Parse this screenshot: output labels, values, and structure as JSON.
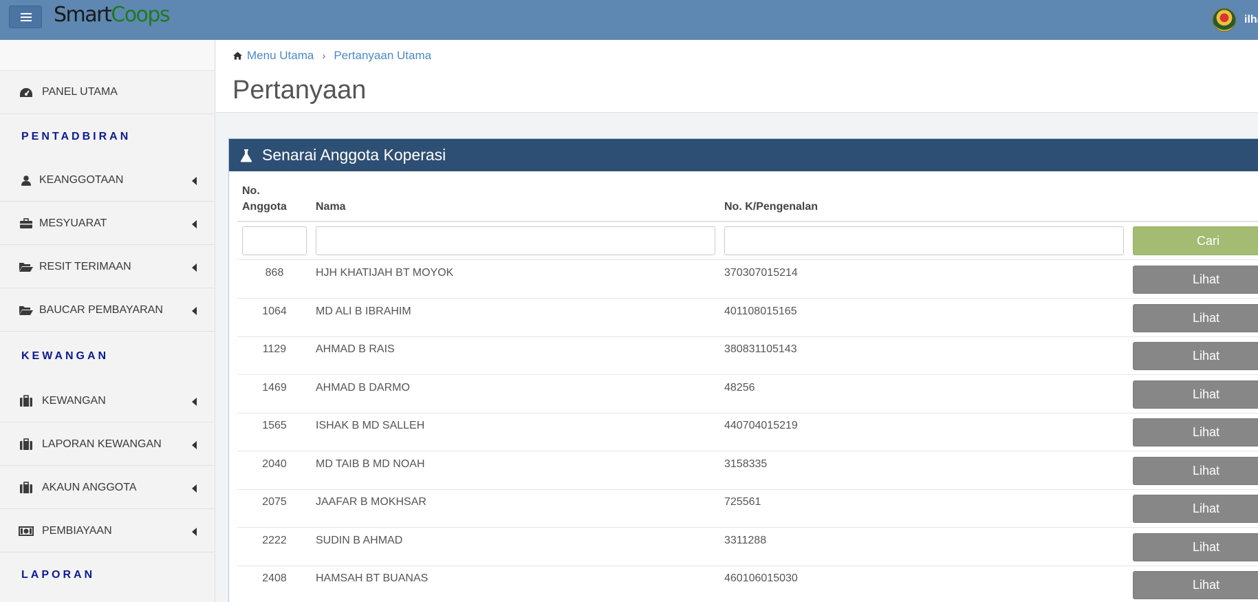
{
  "navbar": {
    "brand_smart": "Smart",
    "brand_coops": "Coops",
    "user_name": "ilham",
    "menu_icon": "hamburger-icon",
    "logo_icon": "coat-of-arms-icon"
  },
  "sidebar": {
    "items": [
      {
        "label": "PANEL UTAMA",
        "icon": "dashboard-icon",
        "has_caret": false
      },
      {
        "section": "PENTADBIRAN"
      },
      {
        "label": "KEANGGOTAAN",
        "icon": "user-icon",
        "has_caret": true
      },
      {
        "label": "MESYUARAT",
        "icon": "briefcase-icon",
        "has_caret": true
      },
      {
        "label": "RESIT TERIMAAN",
        "icon": "folder-open-icon",
        "has_caret": true
      },
      {
        "label": "BAUCAR PEMBAYARAN",
        "icon": "folder-open-icon",
        "has_caret": true
      },
      {
        "section": "KEWANGAN"
      },
      {
        "label": "KEWANGAN",
        "icon": "suitcase-icon",
        "has_caret": true
      },
      {
        "label": "LAPORAN KEWANGAN",
        "icon": "suitcase-icon",
        "has_caret": true
      },
      {
        "label": "AKAUN ANGGOTA",
        "icon": "suitcase-icon",
        "has_caret": true
      },
      {
        "label": "PEMBIAYAAN",
        "icon": "money-icon",
        "has_caret": true
      },
      {
        "section": "LAPORAN"
      }
    ]
  },
  "breadcrumb": {
    "home": "Menu Utama",
    "current": "Pertanyaan Utama"
  },
  "page_title": "Pertanyaan",
  "panel": {
    "title": "Senarai Anggota Koperasi",
    "icon": "flask-icon",
    "columns": {
      "no_anggota_line1": "No.",
      "no_anggota_line2": "Anggota",
      "nama": "Nama",
      "no_kp": "No. K/Pengenalan"
    },
    "filters": {
      "no_anggota": "",
      "nama": "",
      "no_kp": ""
    },
    "search_button": "Cari",
    "view_button": "Lihat",
    "rows": [
      {
        "no": "868",
        "nama": "HJH KHATIJAH BT MOYOK",
        "kp": "370307015214"
      },
      {
        "no": "1064",
        "nama": "MD ALI B IBRAHIM",
        "kp": "401108015165"
      },
      {
        "no": "1129",
        "nama": "AHMAD B RAIS",
        "kp": "380831105143"
      },
      {
        "no": "1469",
        "nama": "AHMAD B DARMO",
        "kp": "48256"
      },
      {
        "no": "1565",
        "nama": "ISHAK B MD SALLEH",
        "kp": "440704015219"
      },
      {
        "no": "2040",
        "nama": "MD TAIB B MD NOAH",
        "kp": "3158335"
      },
      {
        "no": "2075",
        "nama": "JAAFAR B MOKHSAR",
        "kp": "725561"
      },
      {
        "no": "2222",
        "nama": "SUDIN B AHMAD",
        "kp": "3311288"
      },
      {
        "no": "2408",
        "nama": "HAMSAH BT BUANAS",
        "kp": "460106015030"
      }
    ]
  }
}
